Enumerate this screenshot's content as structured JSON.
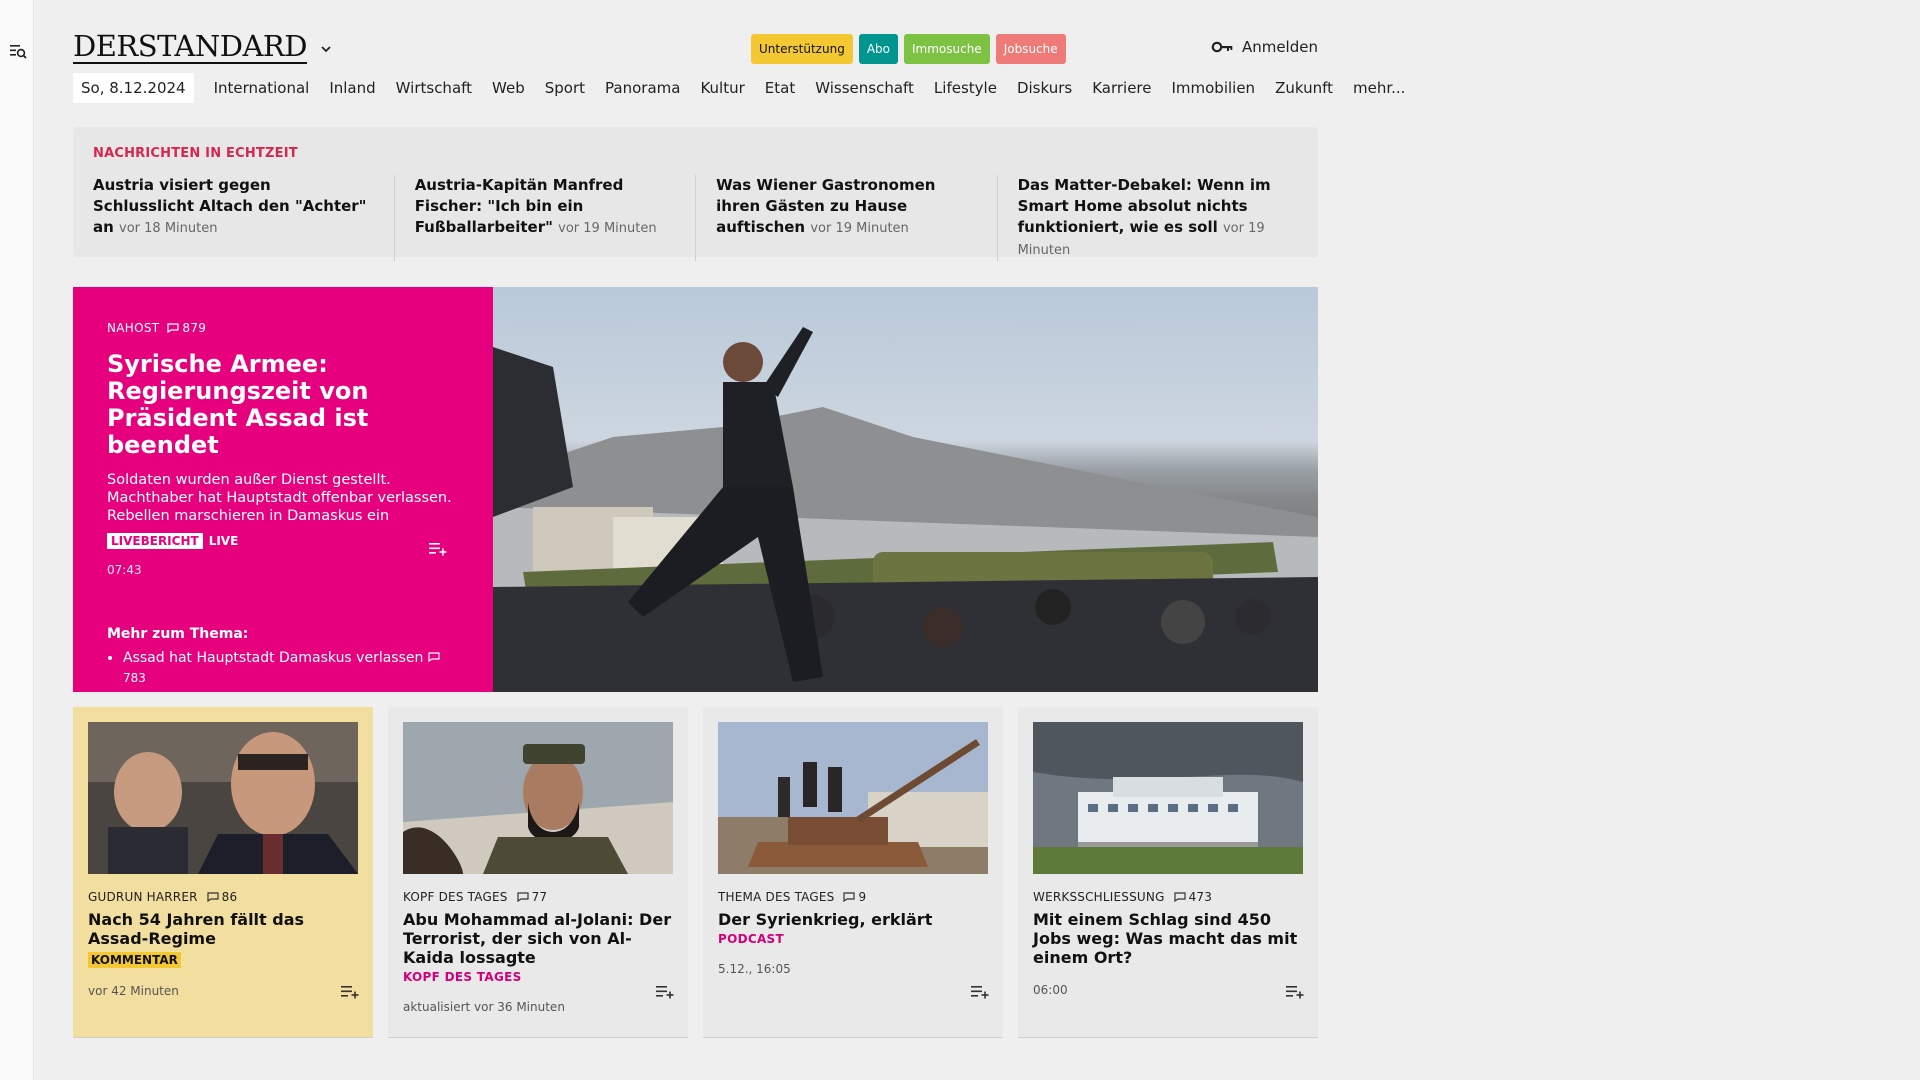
{
  "sidebar": {
    "icon": "search-menu-icon"
  },
  "header": {
    "logo": "DERSTANDARD",
    "pills": [
      {
        "label": "Unterstützung",
        "bg": "#f3c833",
        "fg": "#111111"
      },
      {
        "label": "Abo",
        "bg": "#00968f",
        "fg": "#ffffff"
      },
      {
        "label": "Immosuche",
        "bg": "#7dc242",
        "fg": "#ffffff"
      },
      {
        "label": "Jobsuche",
        "bg": "#ef7b78",
        "fg": "#ffffff"
      }
    ],
    "login": "Anmelden"
  },
  "nav": {
    "date": "So, 8.12.2024",
    "items": [
      "International",
      "Inland",
      "Wirtschaft",
      "Web",
      "Sport",
      "Panorama",
      "Kultur",
      "Etat",
      "Wissenschaft",
      "Lifestyle",
      "Diskurs",
      "Karriere",
      "Immobilien",
      "Zukunft",
      "mehr..."
    ]
  },
  "ticker": {
    "heading": "NACHRICHTEN IN ECHTZEIT",
    "items": [
      {
        "title": "Austria visiert gegen Schlusslicht Altach den \"Achter\" an",
        "time": "vor 18 Minuten"
      },
      {
        "title": "Austria-Kapitän Manfred Fischer: \"Ich bin ein Fußballarbeiter\"",
        "time": "vor 19 Minuten"
      },
      {
        "title": "Was Wiener Gastronomen ihren Gästen zu Hause auftischen",
        "time": "vor 19 Minuten"
      },
      {
        "title": "Das Matter-Debakel: Wenn im Smart Home absolut nichts funktioniert, wie es soll",
        "time": "vor 19 Minuten"
      }
    ]
  },
  "hero": {
    "kicker": "NAHOST",
    "comments": "879",
    "title": "Syrische Armee: Regierungszeit von Präsident Assad ist beendet",
    "lead": "Soldaten wurden außer Dienst gestellt. Machthaber hat Hauptstadt offenbar verlassen. Rebellen marschieren in Damaskus ein",
    "badge": "LIVEBERICHT",
    "live": "LIVE",
    "time": "07:43",
    "more_heading": "Mehr zum Thema:",
    "more_items": [
      {
        "title": "Assad hat Hauptstadt Damaskus verlassen",
        "comments": "783"
      }
    ],
    "accent": "#e6007e"
  },
  "cards": [
    {
      "kicker": "GUDRUN HARRER",
      "comments": "86",
      "title": "Nach 54 Jahren fällt das Assad-Regime",
      "tag": "KOMMENTAR",
      "time": "vor 42 Minuten"
    },
    {
      "kicker": "KOPF DES TAGES",
      "comments": "77",
      "title": "Abu Mohammad al-Jolani: Der Terrorist, der sich von Al-Kaida lossagte",
      "tag": "KOPF DES TAGES",
      "time": "aktualisiert vor 36 Minuten"
    },
    {
      "kicker": "THEMA DES TAGES",
      "comments": "9",
      "title": "Der Syrienkrieg, erklärt",
      "tag": "PODCAST",
      "time": "5.12., 16:05"
    },
    {
      "kicker": "WERKSSCHLIESSUNG",
      "comments": "473",
      "title": "Mit einem Schlag sind 450 Jobs weg: Was macht das mit einem Ort?",
      "tag": "",
      "time": "06:00"
    }
  ]
}
